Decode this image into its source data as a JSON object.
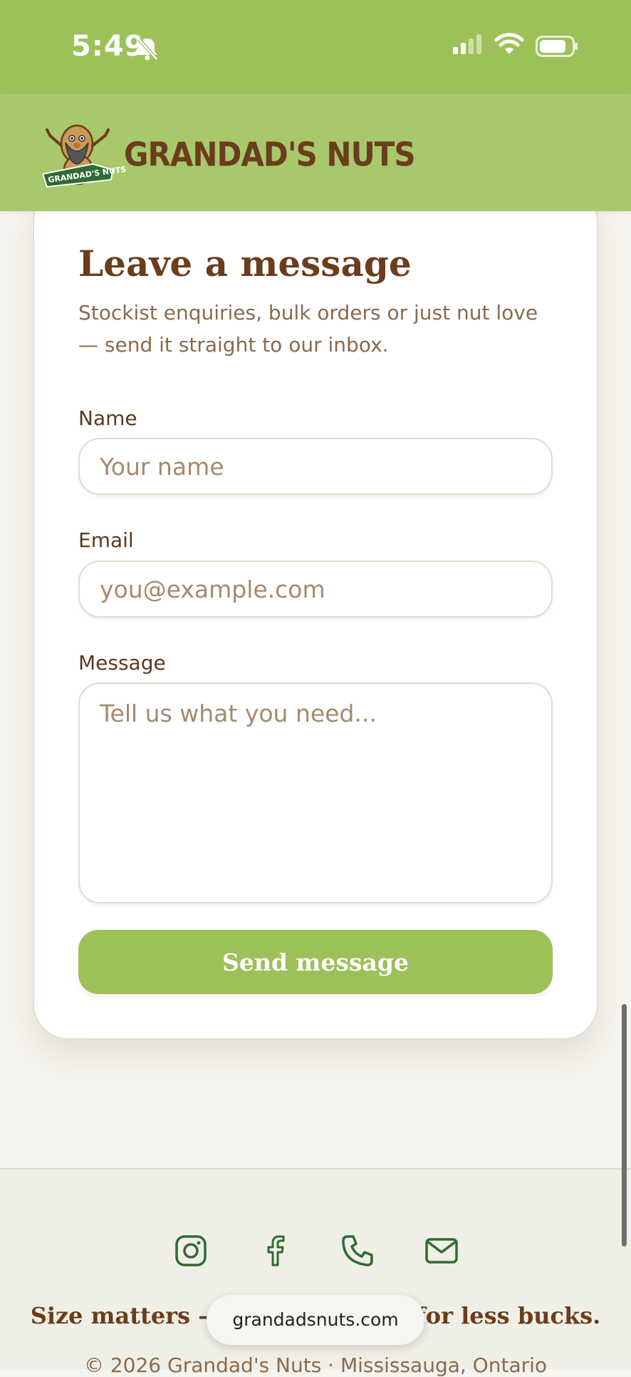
{
  "status_bar": {
    "time": "5:49"
  },
  "header": {
    "brand_name": "GRANDAD'S NUTS",
    "logo_ribbon": "GRANDAD'S NUTS",
    "menu_icon": "hamburger-icon"
  },
  "form": {
    "title": "Leave a message",
    "subtitle": "Stockist enquiries, bulk orders or just nut love — send it straight to our inbox.",
    "name_label": "Name",
    "name_placeholder": "Your name",
    "email_label": "Email",
    "email_placeholder": "you@example.com",
    "message_label": "Message",
    "message_placeholder": "Tell us what you need...",
    "submit_label": "Send message"
  },
  "footer": {
    "social": [
      "instagram-icon",
      "facebook-icon",
      "phone-icon",
      "mail-icon"
    ],
    "tagline": "Size matters — get more nuts for less bucks.",
    "copyright": "© 2026 Grandad's Nuts · Mississauga, Ontario"
  },
  "browser": {
    "url": "grandadsnuts.com"
  },
  "colors": {
    "brand_green": "#9cc159",
    "header_green": "#a7c86b",
    "brand_brown": "#6b3d1c"
  }
}
